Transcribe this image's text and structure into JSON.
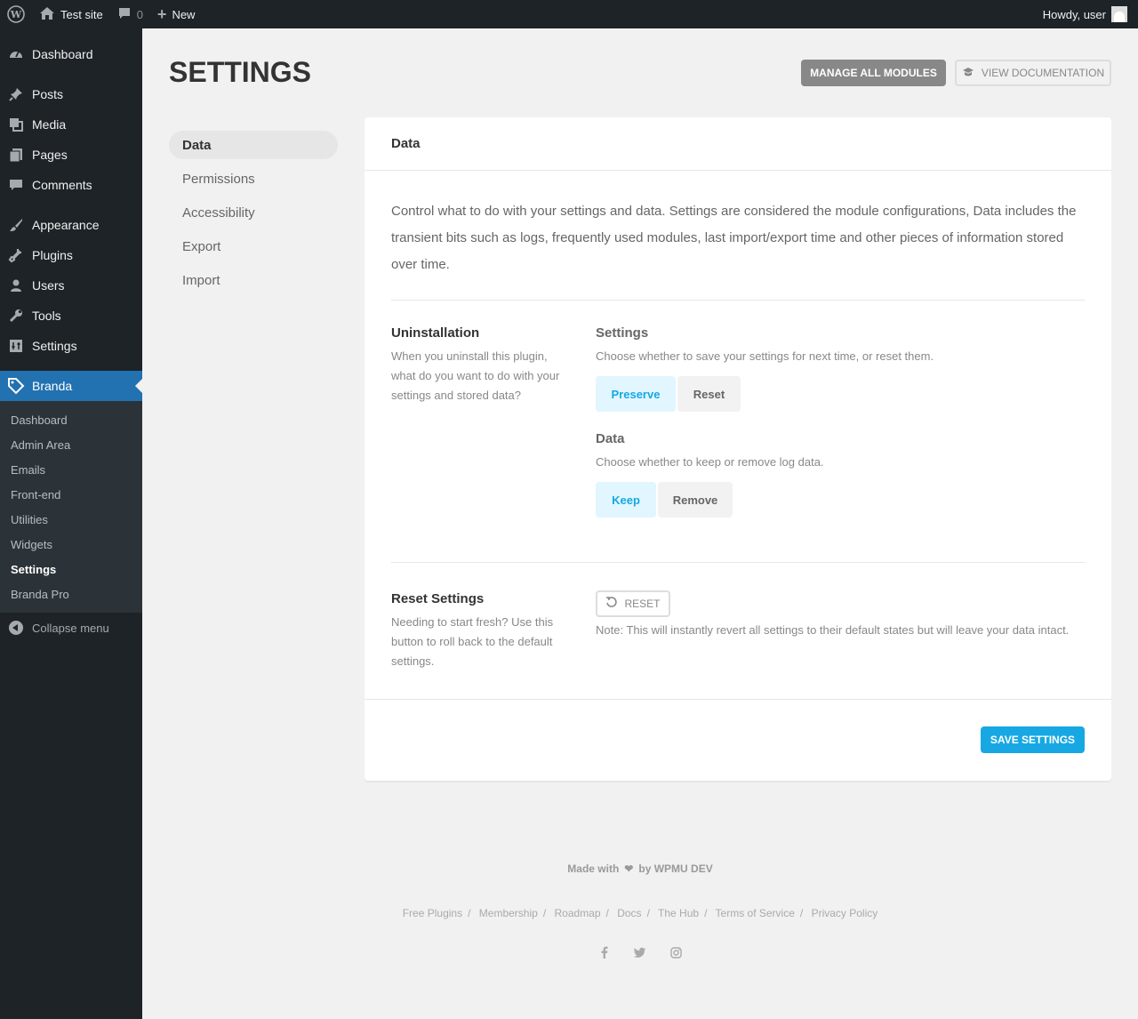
{
  "adminbar": {
    "site_name": "Test site",
    "comments_count": "0",
    "new_label": "New",
    "howdy": "Howdy, user"
  },
  "sidebar": {
    "items": [
      {
        "label": "Dashboard",
        "icon": "dashboard-icon"
      },
      {
        "label": "Posts",
        "icon": "pin-icon"
      },
      {
        "label": "Media",
        "icon": "media-icon"
      },
      {
        "label": "Pages",
        "icon": "pages-icon"
      },
      {
        "label": "Comments",
        "icon": "comment-icon"
      },
      {
        "label": "Appearance",
        "icon": "brush-icon"
      },
      {
        "label": "Plugins",
        "icon": "plug-icon"
      },
      {
        "label": "Users",
        "icon": "user-icon"
      },
      {
        "label": "Tools",
        "icon": "wrench-icon"
      },
      {
        "label": "Settings",
        "icon": "settings-icon"
      },
      {
        "label": "Branda",
        "icon": "tag-icon"
      }
    ],
    "submenu": [
      "Dashboard",
      "Admin Area",
      "Emails",
      "Front-end",
      "Utilities",
      "Widgets",
      "Settings",
      "Branda Pro"
    ],
    "collapse": "Collapse menu"
  },
  "header": {
    "title": "SETTINGS",
    "manage_modules": "MANAGE ALL MODULES",
    "view_docs": "VIEW DOCUMENTATION"
  },
  "tabs": [
    "Data",
    "Permissions",
    "Accessibility",
    "Export",
    "Import"
  ],
  "card": {
    "title": "Data",
    "description": "Control what to do with your settings and data. Settings are considered the module configurations, Data includes the transient bits such as logs, frequently used modules, last import/export time and other pieces of information stored over time.",
    "uninstall": {
      "title": "Uninstallation",
      "text": "When you uninstall this plugin, what do you want to do with your settings and stored data?",
      "settings_title": "Settings",
      "settings_text": "Choose whether to save your settings for next time, or reset them.",
      "preserve": "Preserve",
      "reset": "Reset",
      "data_title": "Data",
      "data_text": "Choose whether to keep or remove log data.",
      "keep": "Keep",
      "remove": "Remove"
    },
    "reset_settings": {
      "title": "Reset Settings",
      "text": "Needing to start fresh? Use this button to roll back to the default settings.",
      "button": "RESET",
      "note": "Note: This will instantly revert all settings to their default states but will leave your data intact."
    },
    "save": "SAVE SETTINGS"
  },
  "footer": {
    "made_with": "Made with",
    "by": "by WPMU DEV",
    "links": [
      "Free Plugins",
      "Membership",
      "Roadmap",
      "Docs",
      "The Hub",
      "Terms of Service",
      "Privacy Policy"
    ]
  },
  "colors": {
    "accent": "#17a8e3",
    "admin_bar": "#1d2327",
    "active_menu": "#2271b1"
  }
}
